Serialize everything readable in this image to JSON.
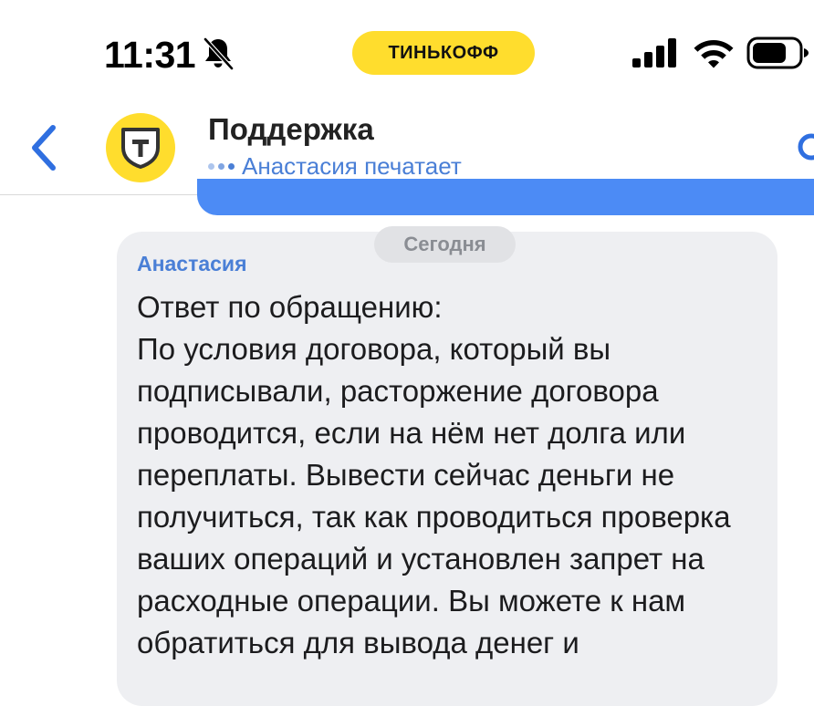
{
  "status_bar": {
    "time": "11:31",
    "carrier": "ТИНЬКОФФ",
    "colors": {
      "carrier_pill": "#FFDD2D"
    },
    "icons": [
      "bell-slash-icon",
      "signal-icon",
      "wifi-icon",
      "battery-icon"
    ]
  },
  "header": {
    "title": "Поддержка",
    "typing_status": "Анастасия печатает",
    "avatar_letter": "T",
    "icons": [
      "back-chevron-icon",
      "search-icon"
    ],
    "colors": {
      "accent": "#4A7FD6",
      "avatar": "#FFDD2D"
    }
  },
  "chat": {
    "date_label": "Сегодня",
    "messages": [
      {
        "sender": "Анастасия",
        "text": "Ответ по обращению:\nПо условия договора, который вы подписывали, расторжение договора проводится, если на нём нет долга или переплаты. Вывести сейчас деньги не получиться, так как проводиться проверка ваших операций и установлен запрет на расходные операции. Вы можете к нам обратиться для вывода денег и"
      }
    ],
    "colors": {
      "bubble": "#EEEFF2",
      "banner": "#4C8BF5"
    }
  }
}
